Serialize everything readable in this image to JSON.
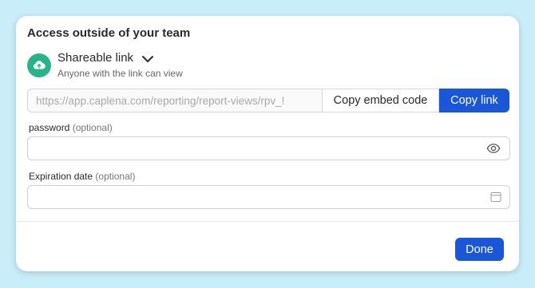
{
  "dialog": {
    "title": "Access outside of your team"
  },
  "share": {
    "icon": "cloud-upload-icon",
    "type_label": "Shareable link",
    "description": "Anyone with the link can view",
    "link_value": "https://app.caplena.com/reporting/report-views/rpv_!",
    "copy_embed_label": "Copy embed code",
    "copy_link_label": "Copy link"
  },
  "password": {
    "label": "password",
    "optional": "(optional)",
    "value": "",
    "icon": "eye-icon"
  },
  "expiration": {
    "label": "Expiration date",
    "optional": "(optional)",
    "value": "",
    "icon": "calendar-icon"
  },
  "footer": {
    "done_label": "Done"
  },
  "colors": {
    "background": "#c9eef9",
    "primary": "#1a56d8",
    "share_icon": "#28b38a"
  }
}
